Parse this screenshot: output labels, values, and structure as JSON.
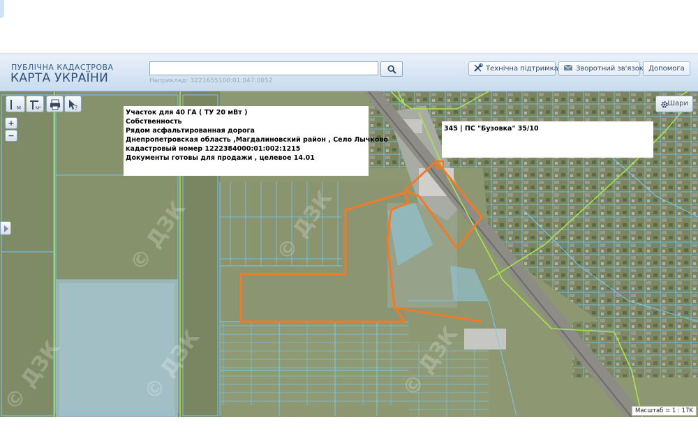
{
  "header": {
    "logo_subtitle": "ПУБЛІЧНА КАДАСТРОВА",
    "logo_title": "КАРТА УКРАЇНИ",
    "search": {
      "value": "",
      "placeholder": "",
      "hint": "Наприклад: 3221655100:01:047:0052"
    },
    "buttons": {
      "support": "Технічна підтримка",
      "feedback": "Зворотний зв'язок",
      "help": "Допомога"
    }
  },
  "map": {
    "layers_button": "Шари",
    "zoom_in": "+",
    "zoom_out": "−",
    "watermark": "© ДЗК",
    "popup_main": {
      "lines": [
        "Участок для   40 ГА ( ТУ 20 мВт  )",
        "Собственность",
        "Рядом асфальтированная дорога",
        "Днепропетровская область ,Магдалиновский район , Село Лычково",
        "кадастровый номер 1222384000:01:002:1215",
        "Документы готовы для продажи , целевое 14.01"
      ]
    },
    "popup_substation": {
      "text": "345 | ПС \"Бузовка\" 35/10"
    },
    "scale": "Масштаб = 1 : 17K",
    "colors": {
      "plot_outline": "#f07a28",
      "parcel_lines": "#78c8ee",
      "boundary_lines": "#a9e34b",
      "header_bg": "#d6e4f3"
    }
  },
  "icons": [
    "search-icon",
    "tools-icon",
    "mail-icon",
    "gear-icon",
    "print-icon",
    "info-cursor-icon",
    "measure-line-icon",
    "measure-area-icon",
    "expand-arrow-icon"
  ]
}
